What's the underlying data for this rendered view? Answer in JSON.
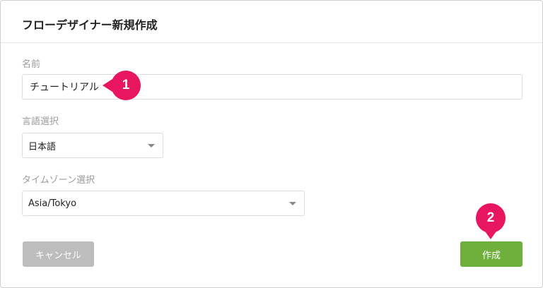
{
  "dialog": {
    "title": "フローデザイナー新規作成"
  },
  "form": {
    "name_label": "名前",
    "name_value": "チュートリアル",
    "language_label": "言語選択",
    "language_value": "日本語",
    "timezone_label": "タイムゾーン選択",
    "timezone_value": "Asia/Tokyo"
  },
  "buttons": {
    "cancel_label": "キャンセル",
    "create_label": "作成"
  },
  "annotations": {
    "step1": "1",
    "step2": "2"
  },
  "colors": {
    "create_button": "#6fb03c",
    "cancel_button": "#bdbdbd",
    "annotation_badge": "#e8155f"
  },
  "icons": {
    "dropdown": "chevron-down-icon"
  }
}
